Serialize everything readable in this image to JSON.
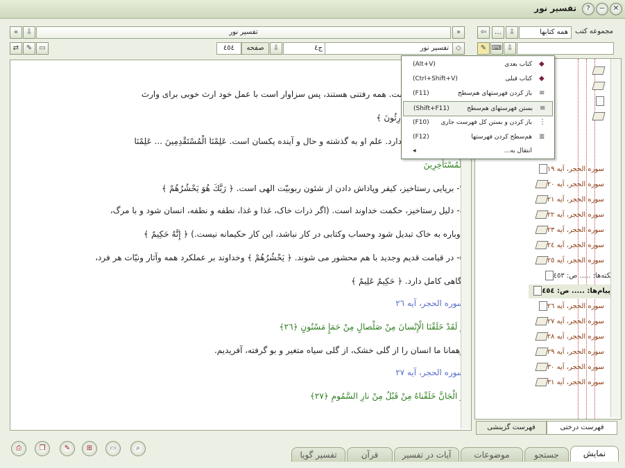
{
  "window": {
    "title": "تفسیر نور"
  },
  "left_header": {
    "book_title": "تفسیر نور",
    "book_combo": "تفسیر نور",
    "volume": "ج٤",
    "page_label": "صفحه",
    "page_number": "٤٥٤"
  },
  "right_header": {
    "group_label": "مجموعه کتب",
    "group_value": "همه کتابها",
    "search_value": ""
  },
  "content_lines": [
    {
      "text": "ات تنها بدست اوست. همه رفتنی هستند، پس سزاوار است با عمل خود ارث خوبی برای وارث",
      "style": ""
    },
    {
      "text": "گذاریم. ﴿ نَحْنُ الْوارِثُونَ ﴾",
      "style": ""
    },
    {
      "text": "علم خداوند اثری ندارد. علم او به گذشته و حال و آینده یکسان است. عَلِمْنَا الْمُسْتَقْدِمِينَ ... عَلِمْنَا",
      "style": ""
    },
    {
      "text": "الْمُسْتَأْخِرِينَ",
      "style": "green"
    },
    {
      "text": "٣- برپایی رستاخیز، کیفر وپاداش دادن از شئون ربوبیّت الهی است. ﴿ رَبَّكَ هُوَ يَحْشُرُهُمْ ﴾",
      "style": ""
    },
    {
      "text": "٤- دلیل رستاخیز، حکمت خداوند است. (اگر ذرات خاک، غذا و غذا، نطفه و نطفه، انسان شود و با مرگ،",
      "style": ""
    },
    {
      "text": "دوباره به خاک تبدیل شود وحساب وکتابی در کار نباشد، این کار حکیمانه نیست.) ﴿ إِنَّهُ حَكِيمٌ ﴾",
      "style": ""
    },
    {
      "text": "٥- در قیامت قدیم وجدید با هم محشور می شوند. ﴿ يَحْشُرُهُمْ ﴾ وخداوند بر عملکرد همه وآثار ونیّات هر فرد،",
      "style": ""
    },
    {
      "text": "آگاهی کامل دارد. ﴿ حَكِيمٌ عَلِيمٌ ﴾",
      "style": ""
    },
    {
      "text": "سوره الحجر، آیه ٢٦",
      "style": "blue"
    },
    {
      "text": "وَ لَقَدْ خَلَقْنَا الْإِنْسانَ مِنْ صَلْصالٍ مِنْ حَمَإٍ مَسْنُونٍ ﴿٢٦﴾",
      "style": "green"
    },
    {
      "text": "وهمانا ما انسان را از گلی خشک، از گلی سیاه متغیر و بو گرفته، آفریدیم.",
      "style": ""
    },
    {
      "text": "سوره الحجر، آیه ٢٧",
      "style": "blue"
    },
    {
      "text": "وَ الْجَانَّ خَلَقْناهُ مِنْ قَبْلُ مِنْ نارِ السَّمُومِ ﴿٢٧﴾",
      "style": "green"
    }
  ],
  "context_menu": [
    {
      "label": "کتاب بعدی",
      "shortcut": "(Alt+V)"
    },
    {
      "label": "کتاب قبلی",
      "shortcut": "(Ctrl+Shift+V)"
    },
    {
      "label": "باز کردن فهرستهای هم‌سطح",
      "shortcut": "(F11)"
    },
    {
      "label": "بستن فهرستهای هم‌سطح",
      "shortcut": "(Shift+F11)"
    },
    {
      "label": "باز کردن و بستن کل فهرست جاری",
      "shortcut": "(F10)"
    },
    {
      "label": "هم‌سطح کردن فهرستها",
      "shortcut": "(F12)"
    },
    {
      "label": "انتقال به...",
      "shortcut": ""
    }
  ],
  "tree_items": [
    {
      "label": "سوره الحجر، آیه ١٩"
    },
    {
      "label": "سوره الحجر، آیه ٢٠"
    },
    {
      "label": "سوره الحجر، آیه ٢١"
    },
    {
      "label": "سوره الحجر، آیه ٢٢"
    },
    {
      "label": "سوره الحجر، آیه ٢٣"
    },
    {
      "label": "سوره الحجر، آیه ٢٤"
    },
    {
      "label": "سوره الحجر، آیه ٢٥"
    },
    {
      "label": "نکته‌ها: ..... ص: ٤٥٣"
    },
    {
      "label": "پیام‌ها: ..... ص: ٤٥٤"
    },
    {
      "label": "سوره الحجر، آیه ٢٦"
    },
    {
      "label": "سوره الحجر، آیه ٢٧"
    },
    {
      "label": "سوره الحجر، آیه ٢٨"
    },
    {
      "label": "سوره الحجر، آیه ٢٩"
    },
    {
      "label": "سوره الحجر، آیه ٣٠"
    },
    {
      "label": "سوره الحجر، آیه ٣١"
    }
  ],
  "right_tabs": [
    "فهرست درختی",
    "فهرست گزینشی"
  ],
  "bottom_tabs": [
    "نمایش",
    "جستجو",
    "موضوعات",
    "آیات در تفسیر",
    "قرآن",
    "تفسیر گویا"
  ]
}
